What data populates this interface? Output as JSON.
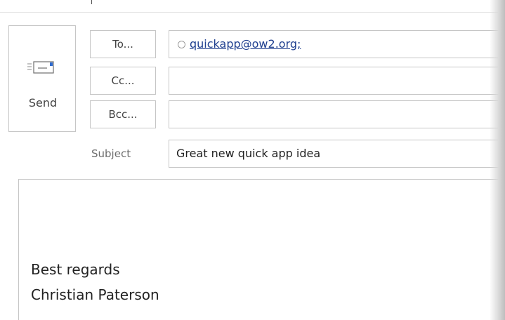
{
  "toolbar": {
    "send_label": "Send",
    "send_icon": "send-envelope-icon"
  },
  "addressing": {
    "to_label": "To...",
    "cc_label": "Cc...",
    "bcc_label": "Bcc...",
    "to_recipient": "quickapp@ow2.org;",
    "cc_value": "",
    "bcc_value": "",
    "presence_icon": "presence-circle-icon"
  },
  "subject": {
    "label": "Subject",
    "value": "Great new quick app idea"
  },
  "body": {
    "signature_line1": "Best regards",
    "signature_line2": "Christian Paterson"
  },
  "colors": {
    "link": "#1f3f8f",
    "border": "#c6c6c6",
    "send_icon_blue": "#2e6bd0"
  }
}
